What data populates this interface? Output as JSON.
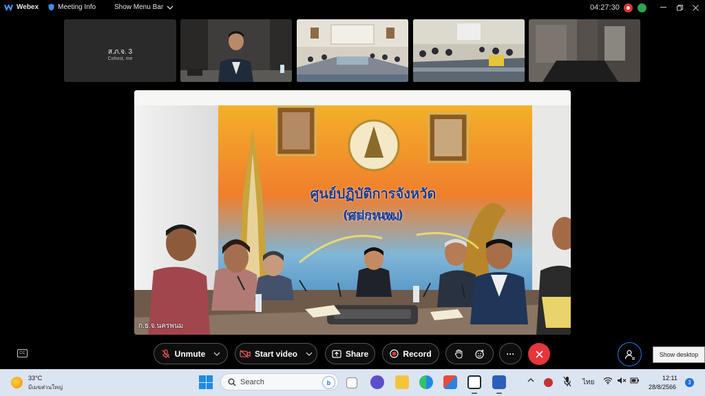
{
  "topbar": {
    "app_name": "Webex",
    "meeting_info": "Meeting Info",
    "show_menu_bar": "Show Menu Bar",
    "timer": "04:27:30",
    "colors": {
      "recording": "#e03535",
      "status": "#2fa44f"
    },
    "icons": [
      "webex-logo-icon",
      "shield-icon",
      "chevron-down-icon",
      "minimize-icon",
      "restore-icon",
      "close-icon"
    ]
  },
  "participants": [
    {
      "name": "ส.ภ.จ. 3",
      "role": "Cohost, me",
      "video": false
    },
    {
      "name": "",
      "video": true
    },
    {
      "name": "",
      "video": true
    },
    {
      "name": "",
      "video": true
    },
    {
      "name": "",
      "video": true
    }
  ],
  "main_video": {
    "label": "ก.ธ.จ.นครพนม",
    "banner_text": [
      "ศูนย์ปฏิบัติการจังหวัดนครพนม",
      "(ศปก.นพ.)"
    ]
  },
  "controls": {
    "unmute": "Unmute",
    "start_video": "Start video",
    "share": "Share",
    "record": "Record",
    "more": "···",
    "end_color": "#e4363c",
    "people_color": "#2c7ae8",
    "tooltip": "Show desktop"
  },
  "taskbar": {
    "weather_temp": "33°C",
    "weather_desc": "มีเมฆส่วนใหญ่",
    "search_placeholder": "Search",
    "lang": "ไทย",
    "time": "12:11",
    "date": "28/8/2566",
    "notifications": "3"
  }
}
